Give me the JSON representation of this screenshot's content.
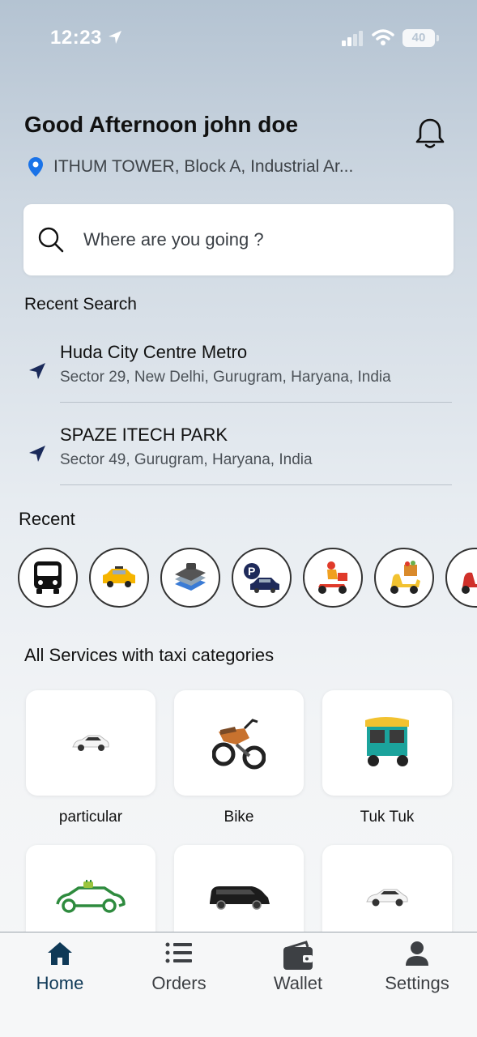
{
  "status_bar": {
    "time": "12:23",
    "battery": "40"
  },
  "header": {
    "greeting": "Good Afternoon john doe",
    "address": "ITHUM TOWER, Block A, Industrial Ar..."
  },
  "search": {
    "placeholder": "Where are you going ?"
  },
  "recent_search": {
    "title": "Recent Search",
    "items": [
      {
        "place": "Huda City Centre Metro",
        "address": "Sector 29, New Delhi, Gurugram, Haryana, India"
      },
      {
        "place": "SPAZE ITECH PARK",
        "address": "Sector 49, Gurugram, Haryana, India"
      }
    ]
  },
  "recent": {
    "title": "Recent",
    "icons": [
      "bus-icon",
      "taxi-icon",
      "laundry-icon",
      "parking-icon",
      "delivery-scooter-icon",
      "grocery-scooter-icon",
      "scooter-icon"
    ]
  },
  "services": {
    "title": "All Services with taxi categories",
    "items": [
      {
        "label": "particular",
        "icon": "white-car-icon"
      },
      {
        "label": "Bike",
        "icon": "motorbike-icon"
      },
      {
        "label": "Tuk Tuk",
        "icon": "tuk-tuk-icon"
      },
      {
        "label": "",
        "icon": "electric-car-icon"
      },
      {
        "label": "",
        "icon": "black-van-icon"
      },
      {
        "label": "",
        "icon": "white-car-icon"
      }
    ]
  },
  "bottom_nav": {
    "items": [
      {
        "label": "Home",
        "icon": "home-icon"
      },
      {
        "label": "Orders",
        "icon": "list-icon"
      },
      {
        "label": "Wallet",
        "icon": "wallet-icon"
      },
      {
        "label": "Settings",
        "icon": "user-icon"
      }
    ]
  },
  "colors": {
    "accent": "#0f3957",
    "nav_arrow": "#1a2a5a",
    "pin": "#1a73e8"
  }
}
